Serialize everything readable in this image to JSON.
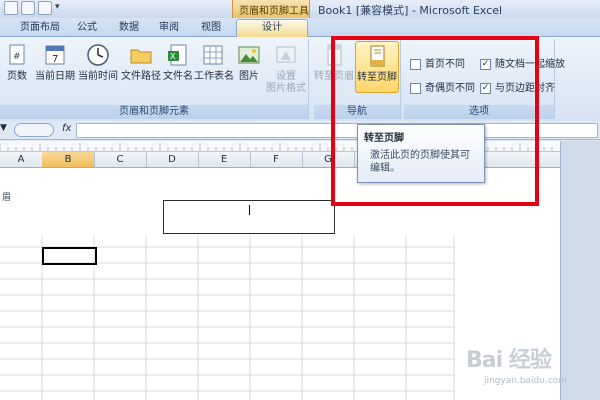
{
  "window": {
    "title": "Book1  [兼容模式] - Microsoft Excel",
    "context_group": "页眉和页脚工具"
  },
  "tabs": [
    {
      "label": "页面布局"
    },
    {
      "label": "公式"
    },
    {
      "label": "数据"
    },
    {
      "label": "审阅"
    },
    {
      "label": "视图"
    },
    {
      "label": "设计",
      "active": true
    }
  ],
  "ribbon": {
    "group_elements": {
      "label": "页眉和页脚元素",
      "buttons": [
        {
          "label": "页数",
          "icon": "page-count-icon"
        },
        {
          "label": "当前日期",
          "icon": "calendar-icon"
        },
        {
          "label": "当前时间",
          "icon": "clock-icon"
        },
        {
          "label": "文件路径",
          "icon": "folder-icon"
        },
        {
          "label": "文件名",
          "icon": "excel-file-icon"
        },
        {
          "label": "工作表名",
          "icon": "sheet-icon"
        },
        {
          "label": "图片",
          "icon": "picture-icon"
        },
        {
          "label": "设置",
          "label2": "图片格式",
          "icon": "format-picture-icon",
          "disabled": true
        }
      ]
    },
    "group_nav": {
      "label": "导航",
      "buttons": [
        {
          "label": "转至页眉",
          "icon": "header-icon",
          "disabled": true
        },
        {
          "label": "转至页脚",
          "icon": "footer-icon",
          "hot": true
        }
      ]
    },
    "group_options": {
      "label": "选项",
      "checks": [
        {
          "label": "首页不同",
          "checked": false
        },
        {
          "label": "奇偶页不同",
          "checked": false
        },
        {
          "label": "随文档一起缩放",
          "checked": true
        },
        {
          "label": "与页边距对齐",
          "checked": true
        }
      ]
    }
  },
  "formula_bar": {
    "fx": "fx",
    "value": ""
  },
  "columns": [
    "A",
    "B",
    "C",
    "D",
    "E",
    "F",
    "G"
  ],
  "selected_column": "B",
  "sheet": {
    "header_label": "眉"
  },
  "tooltip": {
    "title": "转至页脚",
    "body": "激活此页的页脚使其可编辑。"
  },
  "watermark": {
    "text": "Bai 经验",
    "url": "jingyan.baidu.com"
  },
  "colors": {
    "highlight": "#e60012",
    "accent_tab": "#f3d98f"
  }
}
